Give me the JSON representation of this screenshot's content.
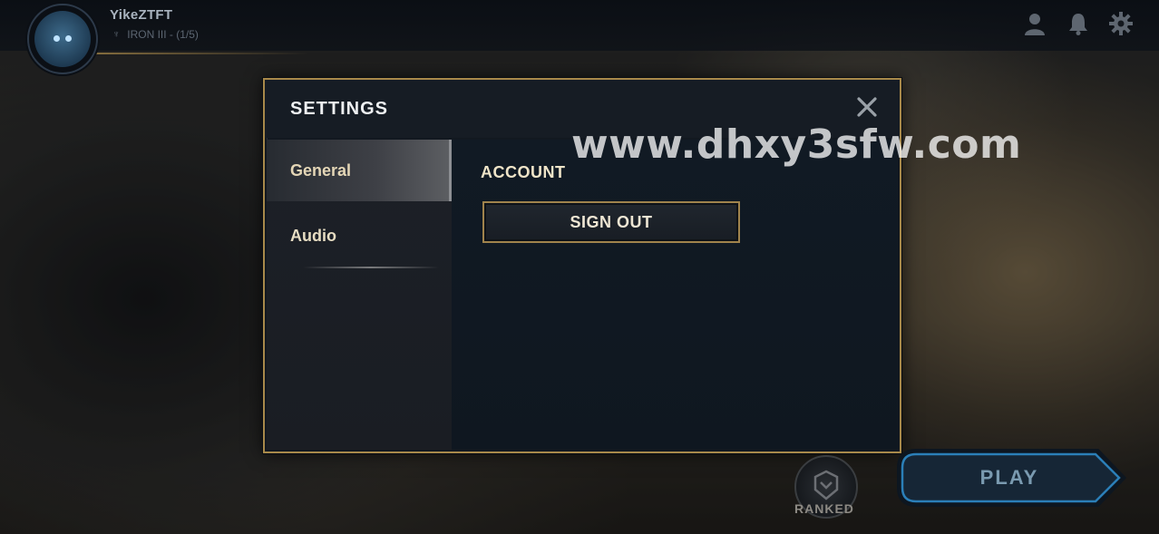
{
  "profile": {
    "username": "YikeZTFT",
    "rank": "IRON III - (1/5)"
  },
  "header_icons": [
    "profile-icon",
    "bell-icon",
    "gear-icon"
  ],
  "watermark": "www.dhxy3sfw.com",
  "settings": {
    "title": "SETTINGS",
    "tabs": [
      {
        "label": "General",
        "selected": true
      },
      {
        "label": "Audio",
        "selected": false
      }
    ],
    "general": {
      "section_label": "ACCOUNT",
      "sign_out_label": "SIGN OUT"
    }
  },
  "bottom": {
    "ranked_label": "RANKED",
    "play_label": "PLAY"
  },
  "colors": {
    "gold_border": "#a8894a",
    "panel_bg": "#121820",
    "play_accent": "#2b7fb8"
  }
}
